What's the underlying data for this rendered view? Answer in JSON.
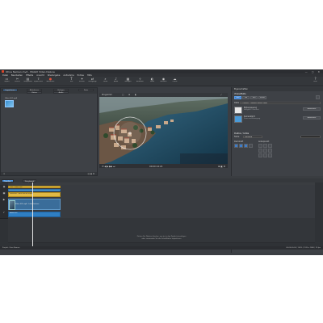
{
  "titlebar": {
    "title": "Ohne Namen.mvd - MAGIX Video Deluxe"
  },
  "window_buttons": "— ▢ ✕",
  "menu": [
    "Datei",
    "Bearbeiten",
    "Effekte",
    "Ansicht",
    "Wiedergabe",
    "Aufnahme",
    "Extras",
    "Hilfe"
  ],
  "toolbar": [
    {
      "label": "Import",
      "icon": "folder-open-icon"
    },
    {
      "label": "Schnitt",
      "icon": "scissors-icon"
    },
    {
      "label": "Storyboard",
      "icon": "storyboard-icon"
    },
    {
      "label": "Exportieren",
      "icon": "export-icon"
    },
    {
      "label": "Aufnahme",
      "icon": "record-icon"
    },
    {
      "label": "Text",
      "icon": "text-icon"
    },
    {
      "label": "Effekte",
      "icon": "fx-icon"
    },
    {
      "label": "Übergänge",
      "icon": "transition-icon"
    },
    {
      "label": "Zoom",
      "icon": "zoom-icon"
    },
    {
      "label": "Audio",
      "icon": "audio-icon"
    },
    {
      "label": "Vorlagen",
      "icon": "template-icon"
    },
    {
      "label": "Bildstabil.",
      "icon": "stabilize-icon"
    },
    {
      "label": "Farbe",
      "icon": "color-icon"
    },
    {
      "label": "Brennen",
      "icon": "burn-icon"
    },
    {
      "label": "Online",
      "icon": "cloud-icon"
    },
    {
      "label": "Hilfe",
      "icon": "help-icon"
    }
  ],
  "left_panel": {
    "tabs": [
      "Importieren",
      "Aufnahmen",
      "Vorlagen",
      "Fotos",
      "Videos",
      "Audio"
    ],
    "active_tab": "Importieren",
    "clip_name": "Video 001.mp4",
    "footer_left": "≡",
    "footer_right": "▤ ▣ ⊞"
  },
  "preview": {
    "toolbar": [
      "Programm",
      "▢",
      "⊕",
      "◐",
      "⤢"
    ],
    "controls": {
      "left": "⏮ ◀ ▶ ▶▶ ⏭",
      "center": "00:00:14:21",
      "right": "⊞ ▣ ⚙"
    }
  },
  "properties": {
    "header": "Eigenschaften",
    "section_title": "Videoeffekte",
    "tab_buttons": [
      "Bild",
      "Ton",
      "Text",
      "Effekt"
    ],
    "file_label": "Datei",
    "file_path": "C:\\Users\\...\\Videos\\Clip001.mp4",
    "item1": {
      "title": "Bildanpassung",
      "sub": "Helligkeit / Kontrast",
      "button": "Anwenden"
    },
    "item2": {
      "title": "Kamerafahrt",
      "sub": "Zoom und Bewegung",
      "button": "Anwenden"
    },
    "section2_title": "Position / Größe",
    "color_label": "Farbe",
    "color_value": "Standard",
    "opacity_label": "Deckkraft",
    "anchor_label": "Ankerpunkt",
    "bottom_buttons": [
      "OK",
      "Zurücksetzen"
    ]
  },
  "timeline": {
    "tabs": [
      "Timeline",
      "Storyboard",
      "Übersicht"
    ],
    "active_tab": "Timeline",
    "tracks": [
      {
        "label": "Titel",
        "clip": "Titel: Comer See"
      },
      {
        "label": "Bauchbinde",
        "clip": "Untertitel - Blick auf die Stadt"
      },
      {
        "label": "Clip",
        "clip": "Video 001.mp4 - Luftaufnahme"
      },
      {
        "label": "Audio",
        "clip": "Audio 001"
      }
    ],
    "hint_line1": "Ziehen Sie Dateien hierher, um sie in das Projekt einzufügen",
    "hint_line2": "oder verwenden Sie die Schaltfläche Importieren",
    "status_left": "Projekt: Ohne Namen",
    "status_right": "00:00:00:00 | 100% | 1920 x 1080 | 25 fps"
  },
  "colors": {
    "accent": "#4a90d9",
    "bg_window": "#3b3e43",
    "clip_yellow": "#e0b946",
    "clip_blue": "#4a9ad8",
    "record": "#e0503a"
  }
}
